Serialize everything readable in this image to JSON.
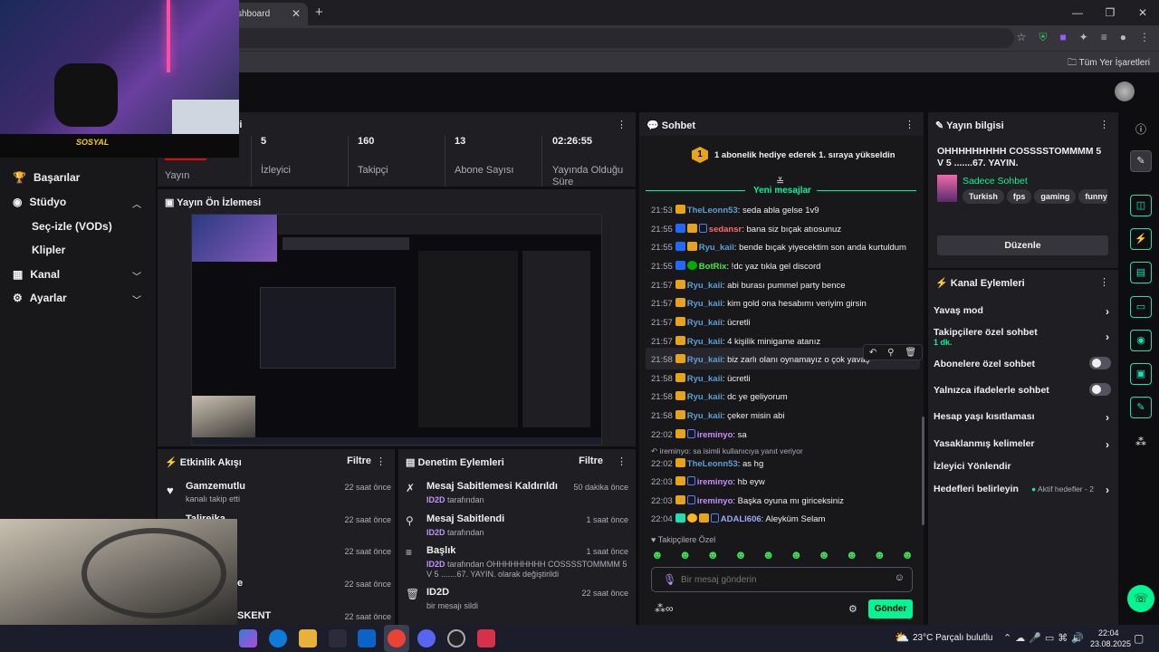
{
  "browser": {
    "tab_title": "shboard",
    "tab_close": "✕",
    "new_tab": "+",
    "bookmarks_all": "Tüm Yer İşaretleri"
  },
  "sidebar": {
    "items": [
      {
        "label": "Başarılar"
      },
      {
        "label": "Stüdyo"
      },
      {
        "label": "Seç-izle (VODs)"
      },
      {
        "label": "Klipler"
      },
      {
        "label": "Kanal"
      },
      {
        "label": "Ayarlar"
      }
    ]
  },
  "stats": {
    "first_label": "Yayın",
    "items": [
      {
        "value": "5",
        "label": "İzleyici"
      },
      {
        "value": "160",
        "label": "Takipçi"
      },
      {
        "value": "13",
        "label": "Abone Sayısı"
      },
      {
        "value": "02:26:55",
        "label": "Yayında Olduğu Süre"
      }
    ]
  },
  "panels": {
    "stats_title_partial": "eri",
    "preview_title": "Yayın Ön İzlemesi",
    "activity_title": "Etkinlik Akışı",
    "activity_filter": "Filtre",
    "mod_title": "Denetim Eylemleri",
    "mod_filter": "Filtre",
    "chat_title": "Sohbet",
    "info_title": "Yayın bilgisi",
    "channel_actions_title": "Kanal Eylemleri"
  },
  "activity": [
    {
      "title": "Gamzemutlu",
      "sub": "kanalı takip etti",
      "time": "22 saat önce"
    },
    {
      "title": "Talireika",
      "sub": "",
      "time": "22 saat önce"
    },
    {
      "title": "",
      "sub": "",
      "time": "22 saat önce"
    },
    {
      "title": "e",
      "sub": "",
      "time": "22 saat önce"
    },
    {
      "title": "SKENT",
      "sub": "",
      "time": "22 saat önce"
    }
  ],
  "moderation": [
    {
      "title": "Mesaj Sabitlemesi Kaldırıldı",
      "user": "ID2D",
      "sub": "tarafından",
      "time": "50 dakika önce"
    },
    {
      "title": "Mesaj Sabitlendi",
      "user": "ID2D",
      "sub": "tarafından",
      "time": "1 saat önce"
    },
    {
      "title": "Başlık",
      "user": "ID2D",
      "sub": "tarafından OHHHHHHHHH COSSSSTOMMMM 5 V 5 .......67. YAYIN. olarak değiştirildi",
      "time": "1 saat önce"
    },
    {
      "title": "ID2D",
      "user": "",
      "sub": "bir mesajı sildi",
      "time": "22 saat önce"
    }
  ],
  "chat": {
    "sub_rank_number": "1",
    "sub_rank_text": "1 abonelik hediye ederek 1. sıraya yükseldin",
    "new_messages": "Yeni mesajlar",
    "messages": [
      {
        "time": "21:53",
        "user": "TheLeonn53",
        "text": ": seda abla gelse 1v9"
      },
      {
        "time": "21:55",
        "user": "sedansr",
        "text": ": bana siz bıçak atıosunuz"
      },
      {
        "time": "21:55",
        "user": "Ryu_kaii",
        "text": ": bende bıçak yiyecektim son anda kurtuldum"
      },
      {
        "time": "21:55",
        "user": "BotRix",
        "text": ": !dc yaz tıkla gel discord"
      },
      {
        "time": "21:57",
        "user": "Ryu_kaii",
        "text": ": abi burası pummel party bence"
      },
      {
        "time": "21:57",
        "user": "Ryu_kaii",
        "text": ": kim gold ona hesabımı veriyim girsin"
      },
      {
        "time": "21:57",
        "user": "Ryu_kaii",
        "text": ": ücretli"
      },
      {
        "time": "21:57",
        "user": "Ryu_kaii",
        "text": ": 4 kişilik minigame atanız"
      },
      {
        "time": "21:58",
        "user": "Ryu_kaii",
        "text": ": biz zarlı olanı oynamayız o çok yavaş"
      },
      {
        "time": "21:58",
        "user": "Ryu_kaii",
        "text": ": ücretli"
      },
      {
        "time": "21:58",
        "user": "Ryu_kaii",
        "text": ": dc ye geliyorum"
      },
      {
        "time": "21:58",
        "user": "Ryu_kaii",
        "text": ": çeker misin abi"
      },
      {
        "time": "22:02",
        "user": "ireminyo",
        "text": ": sa"
      },
      {
        "time": "22:02",
        "user": "TheLeonn53",
        "text": ": as hg"
      },
      {
        "time": "22:03",
        "user": "ireminyo",
        "text": ": hb eyw"
      },
      {
        "time": "22:03",
        "user": "ireminyo",
        "text": ": Başka oyuna mı giriceksiniz"
      },
      {
        "time": "22:04",
        "user": "ADALI606",
        "text": ": Aleyküm Selam"
      }
    ],
    "reply_note": "ireminyo: sa isimli kullanıcıya yanıt veriyor",
    "followers_only": "Takipçilere Özel",
    "input_placeholder": "Bir mesaj gönderin",
    "send_label": "Gönder"
  },
  "stream_info": {
    "title": "OHHHHHHHHH COSSSSTOMMMM 5 V 5 .......67. YAYIN.",
    "category": "Sadece Sohbet",
    "tags": [
      "Turkish",
      "fps",
      "gaming",
      "funny"
    ],
    "edit_label": "Düzenle"
  },
  "channel_actions": [
    {
      "label": "Yavaş mod",
      "sub": ""
    },
    {
      "label": "Takipçilere özel sohbet",
      "sub": "1 dk."
    },
    {
      "label": "Abonelere özel sohbet",
      "sub": ""
    },
    {
      "label": "Yalnızca ifadelerle sohbet",
      "sub": ""
    },
    {
      "label": "Hesap yaşı kısıtlaması",
      "sub": ""
    },
    {
      "label": "Yasaklanmış kelimeler",
      "sub": ""
    },
    {
      "label": "İzleyici Yönlendir",
      "sub": ""
    },
    {
      "label": "Hedefleri belirleyin",
      "sub": "Aktif hedefler - 2"
    }
  ],
  "taskbar": {
    "weather": "23°C  Parçalı bulutlu",
    "time": "22:04",
    "date": "23.08.2025"
  },
  "colors": {
    "accent_green": "#00f593",
    "twitch_purple": "#9147ff",
    "send_green": "#00f593"
  }
}
